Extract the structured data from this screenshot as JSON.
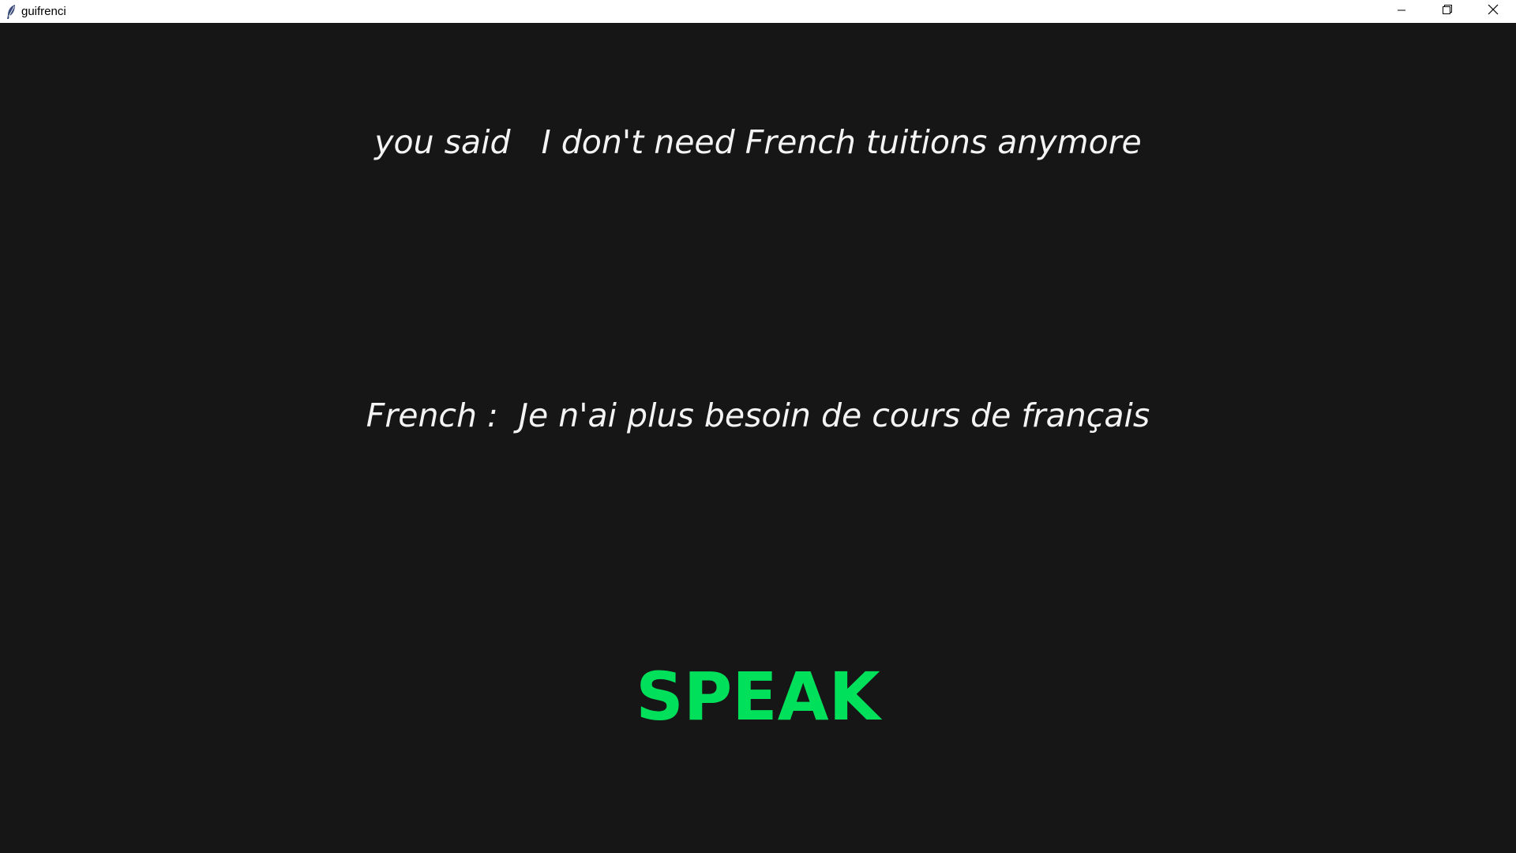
{
  "window": {
    "title": "guifrenci",
    "icon": "feather-icon"
  },
  "controls": {
    "minimize_icon": "minimize-icon",
    "restore_icon": "restore-icon",
    "close_icon": "close-icon"
  },
  "main": {
    "you_said_prefix": "you said",
    "you_said_text": "I don't need French tuitions anymore",
    "french_prefix": "French :",
    "french_text": "Je n'ai plus besoin de cours de français",
    "speak_label": "SPEAK"
  },
  "colors": {
    "background": "#161616",
    "text": "#f4f4f4",
    "speak": "#00e05a",
    "titlebar": "#ffffff"
  }
}
